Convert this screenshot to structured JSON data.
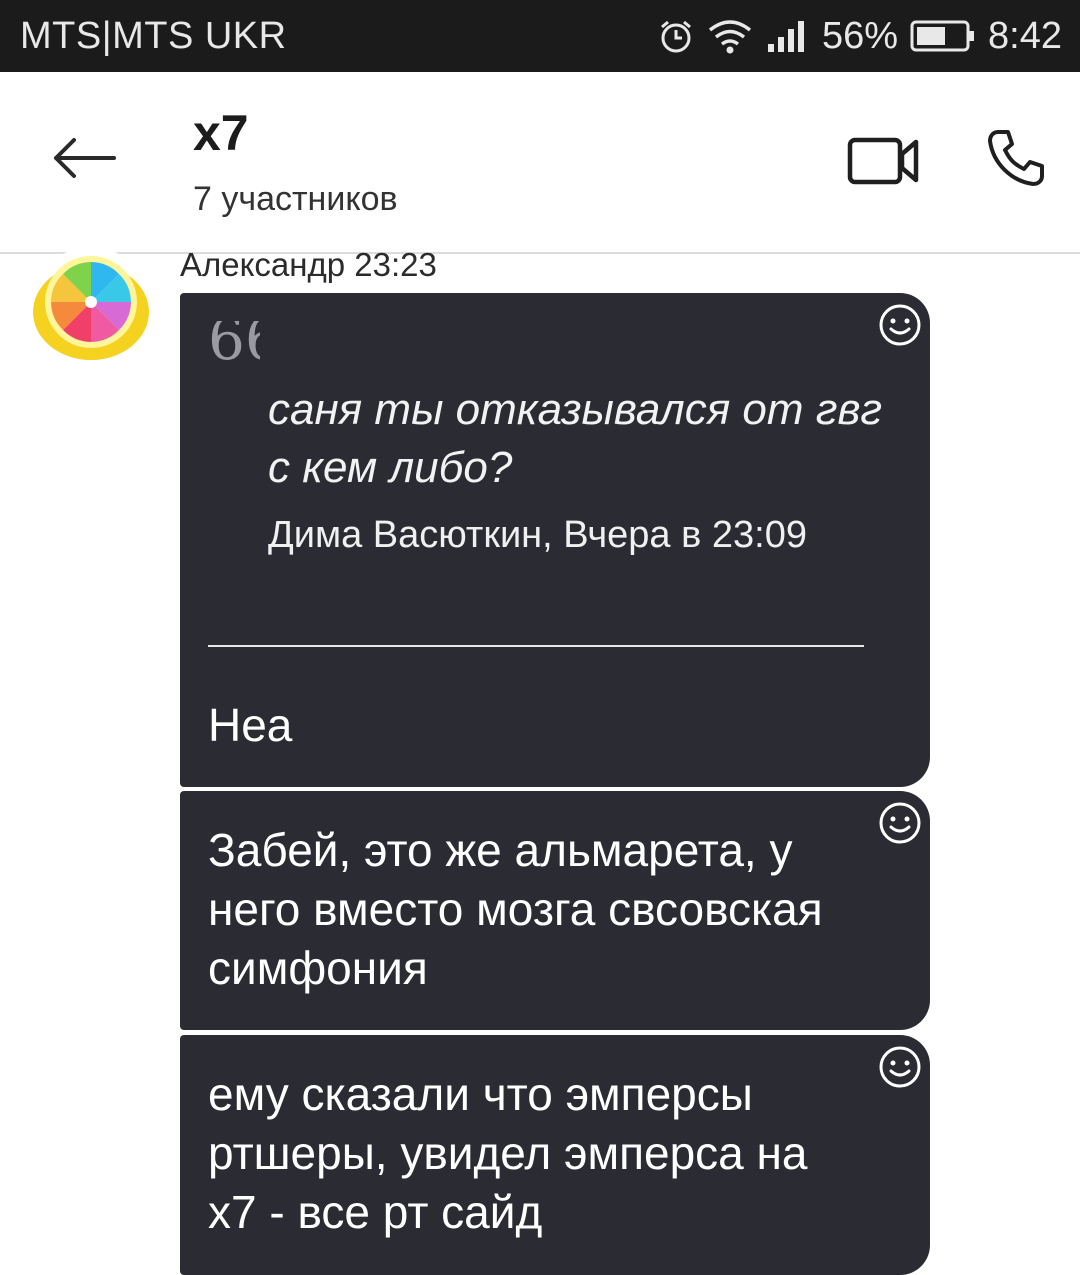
{
  "status_bar": {
    "carrier": "MTS|MTS UKR",
    "battery_percent": "56%",
    "time": "8:42",
    "icons": [
      "alarm-icon",
      "wifi-icon",
      "signal-icon",
      "battery-icon"
    ]
  },
  "header": {
    "title": "x7",
    "subtitle": "7 участников",
    "icons": [
      "back-arrow-icon",
      "video-call-icon",
      "phone-call-icon"
    ]
  },
  "messages": [
    {
      "sender_line": "Александр 23:23",
      "quote": {
        "text": "саня ты отказывался от гвг с кем либо?",
        "author": "Дима Васюткин, Вчера в 23:09"
      },
      "text": "Неа"
    },
    {
      "text": "Забей, это же альмарета, у него вместо мозга свсовская симфония"
    },
    {
      "text": "ему сказали что эмперсы ртшеры, увидел эмперса на x7 - все рт сайд"
    }
  ],
  "colors": {
    "status_bar_bg": "#1b1b1b",
    "bubble_bg": "#2b2c33",
    "header_bg": "#ffffff"
  }
}
